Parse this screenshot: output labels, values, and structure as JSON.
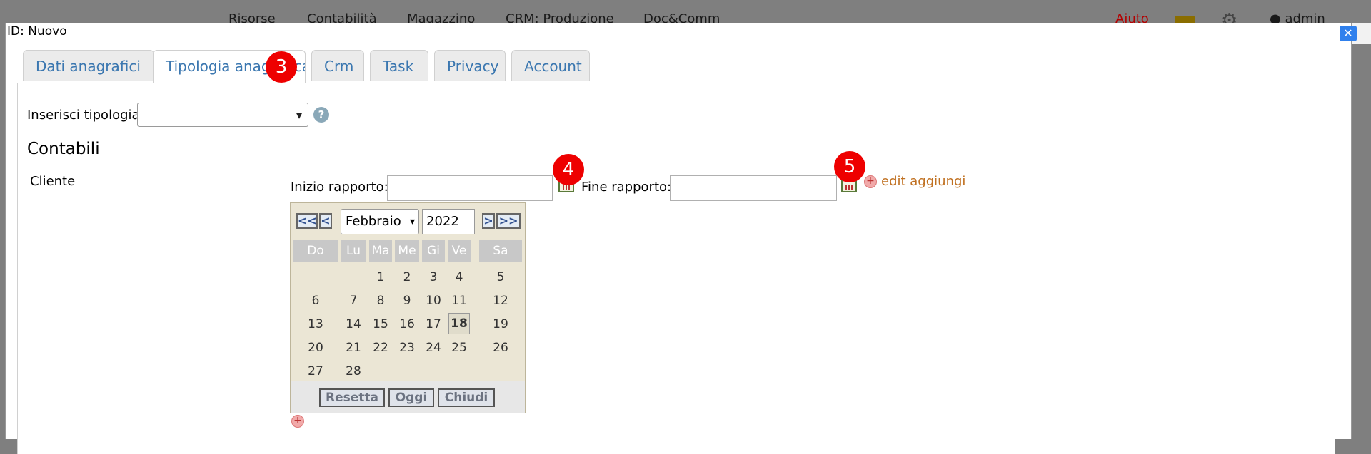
{
  "background_menu": {
    "items": [
      "Risorse",
      "Contabilità",
      "Magazzino",
      "CRM: Produzione",
      "Doc&Comm"
    ],
    "help": "Aiuto",
    "user": "admin"
  },
  "dialog": {
    "title": "ID: Nuovo",
    "tabs": [
      "Dati anagrafici",
      "Tipologia anagrafica",
      "Crm",
      "Task",
      "Privacy",
      "Account"
    ],
    "active_tab": "Tipologia anagrafica"
  },
  "markers": [
    "3",
    "4",
    "5"
  ],
  "form": {
    "type_label": "Inserisci tipologia",
    "type_value": "",
    "section_title": "Contabili",
    "row_label": "Cliente",
    "start_label": "Inizio rapporto:",
    "start_value": "",
    "end_label": "Fine rapporto:",
    "end_value": "",
    "edit_link": "edit aggiungi"
  },
  "calendar": {
    "nav": [
      "<<",
      "<",
      ">",
      ">>"
    ],
    "month": "Febbraio",
    "year": "2022",
    "weekdays": [
      "Do",
      "Lu",
      "Ma",
      "Me",
      "Gi",
      "Ve",
      "Sa"
    ],
    "weeks": [
      [
        "",
        "",
        "1",
        "2",
        "3",
        "4",
        "5"
      ],
      [
        "6",
        "7",
        "8",
        "9",
        "10",
        "11",
        "12"
      ],
      [
        "13",
        "14",
        "15",
        "16",
        "17",
        "18",
        "19"
      ],
      [
        "20",
        "21",
        "22",
        "23",
        "24",
        "25",
        "26"
      ],
      [
        "27",
        "28",
        "",
        "",
        "",
        "",
        ""
      ]
    ],
    "today": "18",
    "buttons": [
      "Resetta",
      "Oggi",
      "Chiudi"
    ]
  },
  "colors": {
    "marker": "#ee0000",
    "tab_text": "#3b77b0",
    "link": "#c07020",
    "close_button": "#2f80ed"
  }
}
